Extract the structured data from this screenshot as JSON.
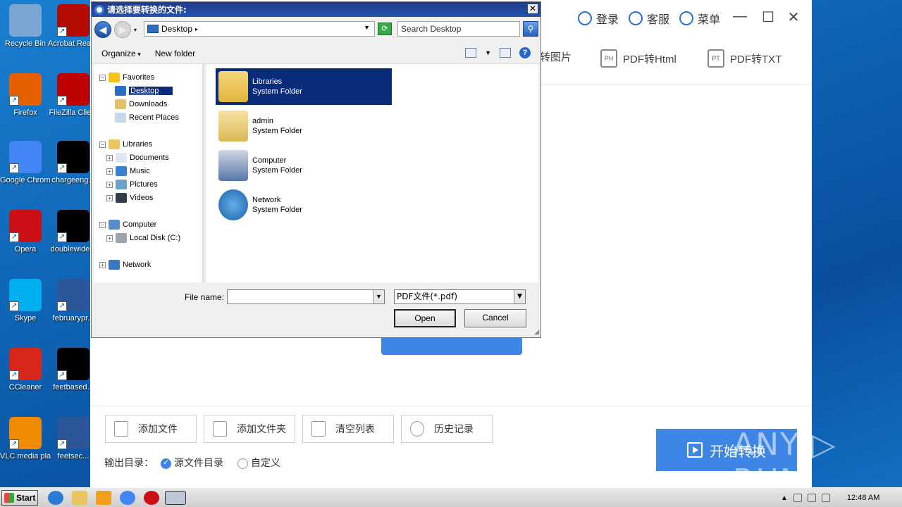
{
  "desktop": {
    "icons": [
      {
        "label": "Recycle Bin",
        "color": "#7aa6d4"
      },
      {
        "label": "Acrobat Reader DC",
        "color": "#b30b00"
      },
      {
        "label": "Firefox",
        "color": "#e66000"
      },
      {
        "label": "FileZilla Client",
        "color": "#bf0000"
      },
      {
        "label": "Google Chrome",
        "color": "#4285f4"
      },
      {
        "label": "chargeeng...",
        "color": "#000000"
      },
      {
        "label": "Opera",
        "color": "#cc0f16"
      },
      {
        "label": "doublewide...",
        "color": "#000000"
      },
      {
        "label": "Skype",
        "color": "#00aff0"
      },
      {
        "label": "februarypr...",
        "color": "#2b579a"
      },
      {
        "label": "CCleaner",
        "color": "#d8261b"
      },
      {
        "label": "feetbased...",
        "color": "#000000"
      },
      {
        "label": "VLC media player",
        "color": "#f08a00"
      },
      {
        "label": "feetsec...",
        "color": "#2b579a"
      }
    ]
  },
  "app": {
    "top": {
      "login": "登录",
      "service": "客服",
      "menu": "菜单"
    },
    "window_controls": {
      "minimize": "—",
      "maximize": "☐",
      "close": "✕"
    },
    "tabs": [
      {
        "label": "转图片",
        "icon_text": ""
      },
      {
        "label": "PDF转Html",
        "icon_text": "PH"
      },
      {
        "label": "PDF转TXT",
        "icon_text": "PT"
      }
    ],
    "bottom_buttons": [
      {
        "label": "添加文件"
      },
      {
        "label": "添加文件夹"
      },
      {
        "label": "清空列表"
      },
      {
        "label": "历史记录"
      }
    ],
    "output_label": "输出目录：",
    "output_options": [
      {
        "label": "源文件目录",
        "checked": true
      },
      {
        "label": "自定义",
        "checked": false
      }
    ],
    "start_button": "开始转换"
  },
  "watermark": "ANY ▷ RUN",
  "dialog": {
    "title": "请选择要转换的文件:",
    "close": "✕",
    "address": "Desktop",
    "search_placeholder": "Search Desktop",
    "toolbar": {
      "organize": "Organize",
      "new_folder": "New folder",
      "help": "?"
    },
    "tree": {
      "favorites": "Favorites",
      "desktop": "Desktop",
      "downloads": "Downloads",
      "recent": "Recent Places",
      "libraries": "Libraries",
      "documents": "Documents",
      "music": "Music",
      "pictures": "Pictures",
      "videos": "Videos",
      "computer": "Computer",
      "local_disk": "Local Disk (C:)",
      "network": "Network"
    },
    "items": [
      {
        "name": "Libraries",
        "type": "System Folder",
        "selected": true
      },
      {
        "name": "admin",
        "type": "System Folder",
        "selected": false
      },
      {
        "name": "Computer",
        "type": "System Folder",
        "selected": false
      },
      {
        "name": "Network",
        "type": "System Folder",
        "selected": false
      }
    ],
    "file_name_label": "File name:",
    "file_name_value": "",
    "file_type": "PDF文件(*.pdf)",
    "open": "Open",
    "cancel": "Cancel"
  },
  "taskbar": {
    "start": "Start",
    "clock": "12:48 AM"
  }
}
